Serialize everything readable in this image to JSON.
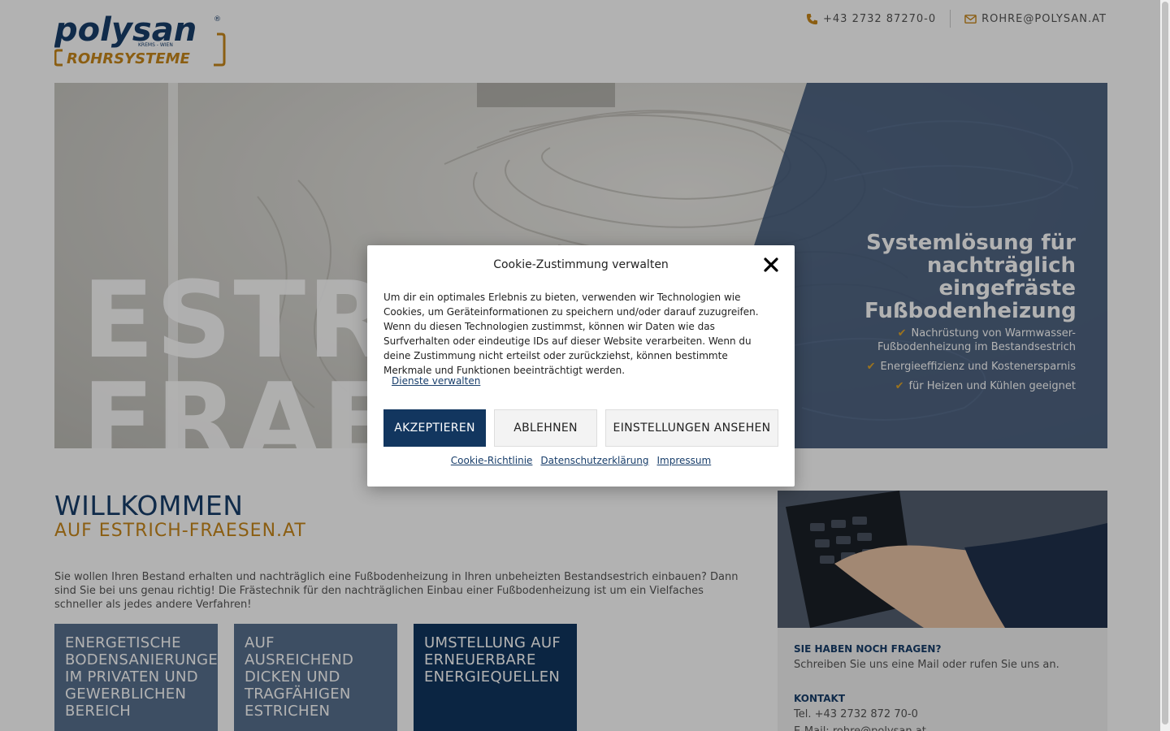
{
  "header": {
    "logo_text": "polysan",
    "logo_sub": "ROHRSYSTEME",
    "logo_tag": "KREMS - WIEN",
    "phone": "+43 2732 87270-0",
    "email": "ROHRE@POLYSAN.AT",
    "phone_icon": "phone-icon",
    "email_icon": "envelope-icon"
  },
  "hero": {
    "big_text_line1": "ESTRIC",
    "big_text_line2": "FRAES",
    "headline": "Systemlösung für nachträglich eingefräste Fußbodenheizung",
    "features": [
      "Nachrüstung von Warmwasser-Fußbodenheizung im Bestandsestrich",
      "Energieeffizienz und Kostenersparnis",
      "für Heizen und Kühlen geeignet"
    ]
  },
  "welcome": {
    "title": "WILLKOMMEN",
    "subtitle": "AUF ESTRICH-FRAESEN.AT",
    "text": "Sie wollen Ihren Bestand erhalten und nachträglich eine Fußbodenheizung in Ihren unbeheizten Bestandsestrich einbauen? Dann sind Sie bei uns genau richtig! Die Frästechnik für den nachträglichen Einbau einer Fußbodenheizung ist um ein Vielfaches schneller als jedes andere Verfahren!"
  },
  "tiles": [
    {
      "label": "ENERGETISCHE BODENSANIERUNGEN IM PRIVATEN UND GEWERBLICHEN BEREICH"
    },
    {
      "label": "AUF AUSREICHEND DICKEN UND TRAGFÄHIGEN ESTRICHEN"
    },
    {
      "label": "UMSTELLUNG AUF ERNEUERBARE ENERGIEQUELLEN"
    }
  ],
  "sidebar": {
    "questions_title": "SIE HABEN NOCH FRAGEN?",
    "questions_text": "Schreiben Sie uns eine Mail oder rufen Sie uns an.",
    "contact_title": "KONTAKT",
    "contact_phone": "Tel. +43 2732 872 70-0",
    "contact_mail": "E-Mail: rohre@polysan.at"
  },
  "cookie_modal": {
    "title": "Cookie-Zustimmung verwalten",
    "text": "Um dir ein optimales Erlebnis zu bieten, verwenden wir Technologien wie Cookies, um Geräteinformationen zu speichern und/oder darauf zuzugreifen. Wenn du diesen Technologien zustimmst, können wir Daten wie das Surfverhalten oder eindeutige IDs auf dieser Website verarbeiten. Wenn du deine Zustimmung nicht erteilst oder zurückziehst, können bestimmte Merkmale und Funktionen beeinträchtigt werden.",
    "manage_link": "Dienste verwalten",
    "accept": "AKZEPTIEREN",
    "deny": "ABLEHNEN",
    "settings": "EINSTELLUNGEN ANSEHEN",
    "links": [
      "Cookie-Richtlinie",
      "Datenschutzerklärung",
      "Impressum"
    ]
  },
  "colors": {
    "brand_blue": "#183e6b",
    "brand_orange": "#c8871b",
    "accept_button": "#12365f"
  }
}
